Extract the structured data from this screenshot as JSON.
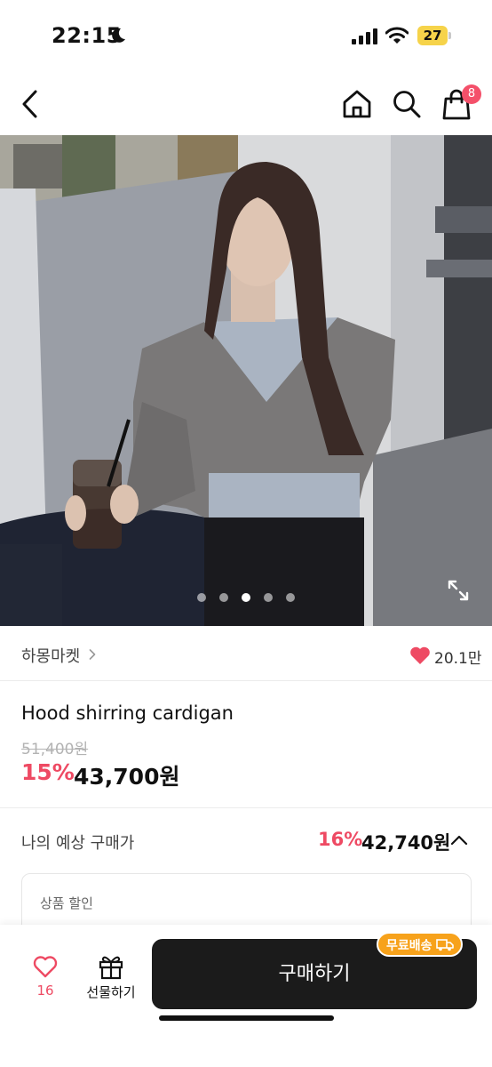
{
  "status_bar": {
    "time": "22:15",
    "battery": "27",
    "icons": [
      "moon-icon",
      "signal-icon",
      "wifi-icon",
      "battery-icon"
    ]
  },
  "nav": {
    "icons": [
      "back-icon",
      "home-icon",
      "search-icon",
      "cart-icon"
    ],
    "cart_badge": "8"
  },
  "gallery": {
    "slide_count": 5,
    "active_slide": 3,
    "expand_icon": "expand-icon"
  },
  "store": {
    "name": "하몽마켓",
    "like_count": "20.1만",
    "accent": "#ee4a63"
  },
  "product": {
    "title": "Hood shirring cardigan",
    "original_price": "51,400원",
    "discount": "15%",
    "sale_price": "43,700원"
  },
  "expected_price": {
    "label": "나의 예상 구매가",
    "discount": "16%",
    "price": "42,740원"
  },
  "discount_detail": {
    "label": "상품 할인"
  },
  "action_bar": {
    "wish_count": "16",
    "gift_label": "선물하기",
    "buy_label": "구매하기",
    "free_shipping": "무료배송",
    "buy_color": "#1b1b1b",
    "shipping_color": "#f7a21b"
  }
}
